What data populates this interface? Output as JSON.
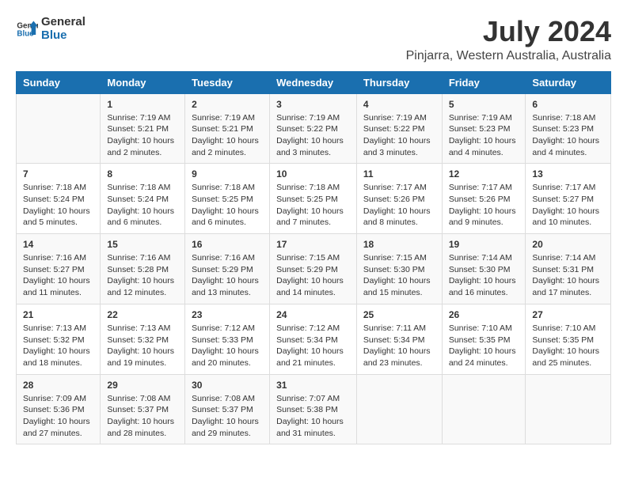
{
  "logo": {
    "line1": "General",
    "line2": "Blue"
  },
  "title": "July 2024",
  "subtitle": "Pinjarra, Western Australia, Australia",
  "days_of_week": [
    "Sunday",
    "Monday",
    "Tuesday",
    "Wednesday",
    "Thursday",
    "Friday",
    "Saturday"
  ],
  "weeks": [
    [
      {
        "day": "",
        "info": ""
      },
      {
        "day": "1",
        "info": "Sunrise: 7:19 AM\nSunset: 5:21 PM\nDaylight: 10 hours\nand 2 minutes."
      },
      {
        "day": "2",
        "info": "Sunrise: 7:19 AM\nSunset: 5:21 PM\nDaylight: 10 hours\nand 2 minutes."
      },
      {
        "day": "3",
        "info": "Sunrise: 7:19 AM\nSunset: 5:22 PM\nDaylight: 10 hours\nand 3 minutes."
      },
      {
        "day": "4",
        "info": "Sunrise: 7:19 AM\nSunset: 5:22 PM\nDaylight: 10 hours\nand 3 minutes."
      },
      {
        "day": "5",
        "info": "Sunrise: 7:19 AM\nSunset: 5:23 PM\nDaylight: 10 hours\nand 4 minutes."
      },
      {
        "day": "6",
        "info": "Sunrise: 7:18 AM\nSunset: 5:23 PM\nDaylight: 10 hours\nand 4 minutes."
      }
    ],
    [
      {
        "day": "7",
        "info": "Sunrise: 7:18 AM\nSunset: 5:24 PM\nDaylight: 10 hours\nand 5 minutes."
      },
      {
        "day": "8",
        "info": "Sunrise: 7:18 AM\nSunset: 5:24 PM\nDaylight: 10 hours\nand 6 minutes."
      },
      {
        "day": "9",
        "info": "Sunrise: 7:18 AM\nSunset: 5:25 PM\nDaylight: 10 hours\nand 6 minutes."
      },
      {
        "day": "10",
        "info": "Sunrise: 7:18 AM\nSunset: 5:25 PM\nDaylight: 10 hours\nand 7 minutes."
      },
      {
        "day": "11",
        "info": "Sunrise: 7:17 AM\nSunset: 5:26 PM\nDaylight: 10 hours\nand 8 minutes."
      },
      {
        "day": "12",
        "info": "Sunrise: 7:17 AM\nSunset: 5:26 PM\nDaylight: 10 hours\nand 9 minutes."
      },
      {
        "day": "13",
        "info": "Sunrise: 7:17 AM\nSunset: 5:27 PM\nDaylight: 10 hours\nand 10 minutes."
      }
    ],
    [
      {
        "day": "14",
        "info": "Sunrise: 7:16 AM\nSunset: 5:27 PM\nDaylight: 10 hours\nand 11 minutes."
      },
      {
        "day": "15",
        "info": "Sunrise: 7:16 AM\nSunset: 5:28 PM\nDaylight: 10 hours\nand 12 minutes."
      },
      {
        "day": "16",
        "info": "Sunrise: 7:16 AM\nSunset: 5:29 PM\nDaylight: 10 hours\nand 13 minutes."
      },
      {
        "day": "17",
        "info": "Sunrise: 7:15 AM\nSunset: 5:29 PM\nDaylight: 10 hours\nand 14 minutes."
      },
      {
        "day": "18",
        "info": "Sunrise: 7:15 AM\nSunset: 5:30 PM\nDaylight: 10 hours\nand 15 minutes."
      },
      {
        "day": "19",
        "info": "Sunrise: 7:14 AM\nSunset: 5:30 PM\nDaylight: 10 hours\nand 16 minutes."
      },
      {
        "day": "20",
        "info": "Sunrise: 7:14 AM\nSunset: 5:31 PM\nDaylight: 10 hours\nand 17 minutes."
      }
    ],
    [
      {
        "day": "21",
        "info": "Sunrise: 7:13 AM\nSunset: 5:32 PM\nDaylight: 10 hours\nand 18 minutes."
      },
      {
        "day": "22",
        "info": "Sunrise: 7:13 AM\nSunset: 5:32 PM\nDaylight: 10 hours\nand 19 minutes."
      },
      {
        "day": "23",
        "info": "Sunrise: 7:12 AM\nSunset: 5:33 PM\nDaylight: 10 hours\nand 20 minutes."
      },
      {
        "day": "24",
        "info": "Sunrise: 7:12 AM\nSunset: 5:34 PM\nDaylight: 10 hours\nand 21 minutes."
      },
      {
        "day": "25",
        "info": "Sunrise: 7:11 AM\nSunset: 5:34 PM\nDaylight: 10 hours\nand 23 minutes."
      },
      {
        "day": "26",
        "info": "Sunrise: 7:10 AM\nSunset: 5:35 PM\nDaylight: 10 hours\nand 24 minutes."
      },
      {
        "day": "27",
        "info": "Sunrise: 7:10 AM\nSunset: 5:35 PM\nDaylight: 10 hours\nand 25 minutes."
      }
    ],
    [
      {
        "day": "28",
        "info": "Sunrise: 7:09 AM\nSunset: 5:36 PM\nDaylight: 10 hours\nand 27 minutes."
      },
      {
        "day": "29",
        "info": "Sunrise: 7:08 AM\nSunset: 5:37 PM\nDaylight: 10 hours\nand 28 minutes."
      },
      {
        "day": "30",
        "info": "Sunrise: 7:08 AM\nSunset: 5:37 PM\nDaylight: 10 hours\nand 29 minutes."
      },
      {
        "day": "31",
        "info": "Sunrise: 7:07 AM\nSunset: 5:38 PM\nDaylight: 10 hours\nand 31 minutes."
      },
      {
        "day": "",
        "info": ""
      },
      {
        "day": "",
        "info": ""
      },
      {
        "day": "",
        "info": ""
      }
    ]
  ]
}
